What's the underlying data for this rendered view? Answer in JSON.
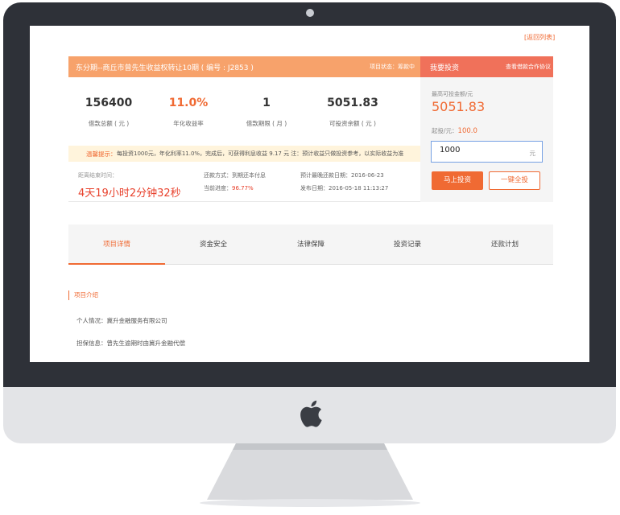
{
  "back_link": "[返回列表]",
  "project": {
    "title": "东分期--商丘市曾先生收益权转让10期 ( 编号 : J2853 )",
    "status": "项目状态：筹款中"
  },
  "invest_header": {
    "title": "我要投资",
    "agreement_link": "查看借款合作协议"
  },
  "stats": [
    {
      "value": "156400",
      "label": "借款总额 ( 元 )"
    },
    {
      "value": "11.0%",
      "label": "年化收益率"
    },
    {
      "value": "1",
      "label": "借款期限 ( 月 )"
    },
    {
      "value": "5051.83",
      "label": "可投资余额 ( 元 )"
    }
  ],
  "tip": {
    "label": "温馨提示：",
    "text": "每投资1000元，年化利率11.0%，完成后，可获得利息收益 9.17 元 注：预计收益只做投资参考，以实际收益为准"
  },
  "countdown": {
    "label": "距离结束时间：",
    "value": "4天19小时2分钟32秒"
  },
  "info": {
    "repay_method": "还款方式：到期还本付息",
    "progress_label": "当前进度：",
    "progress_value": "96.77%",
    "expected_date": "预计最晚还款日期：2016-06-23",
    "publish_date": "发布日期：2016-05-18 11:13:27"
  },
  "invest_panel": {
    "max_label": "最高可投金额/元",
    "max_value": "5051.83",
    "min_label": "起投/元：",
    "min_value": "100.0",
    "amount_value": "1000",
    "amount_unit": "元",
    "invest_button": "马上投资",
    "invest_all_button": "一键全投"
  },
  "tabs": [
    "项目详情",
    "资金安全",
    "法律保障",
    "投资记录",
    "还款计划"
  ],
  "details": {
    "section_title": "项目介绍",
    "personal": "个人情况：冀升金融服务有限公司",
    "guarantee": "担保信息：曾先生逾期时由冀升金融代偿"
  },
  "colors": {
    "accent": "#f06a33",
    "header": "#f7a26b",
    "invest_header": "#f0715a",
    "countdown": "#e8412c",
    "bezel": "#2e3138"
  }
}
